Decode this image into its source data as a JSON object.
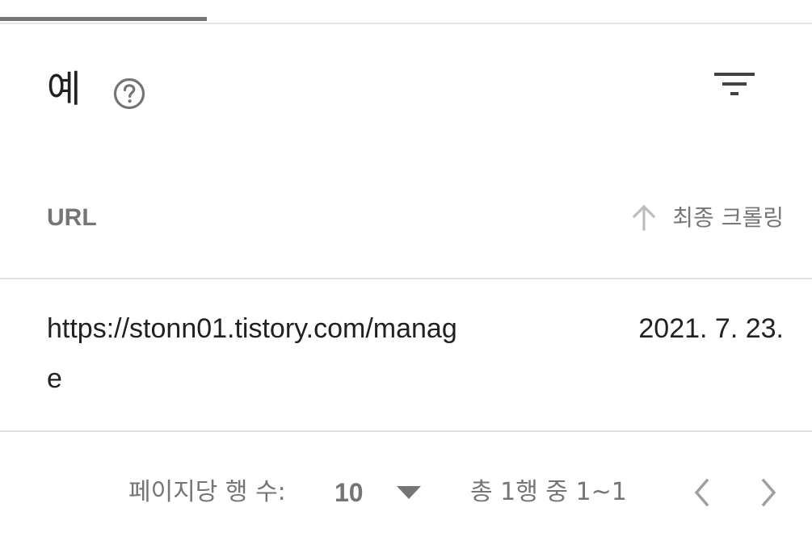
{
  "card": {
    "title": "예",
    "help_icon": "help-circle-icon",
    "filter_icon": "filter-icon"
  },
  "table": {
    "columns": {
      "url": "URL",
      "last_crawled": "최종 크롤링"
    },
    "sort_icon": "arrow-up-icon",
    "rows": [
      {
        "url": "https://stonn01.tistory.com/manage",
        "last_crawled": "2021. 7. 23."
      }
    ]
  },
  "pagination": {
    "rows_per_page_label": "페이지당 행 수:",
    "rows_per_page_value": "10",
    "range_label": "총 1행 중 1~1",
    "prev_icon": "chevron-left-icon",
    "next_icon": "chevron-right-icon"
  },
  "colors": {
    "text_primary": "#212121",
    "text_secondary": "#757575",
    "divider": "#e0e0e0",
    "tab_indicator": "#757575"
  }
}
